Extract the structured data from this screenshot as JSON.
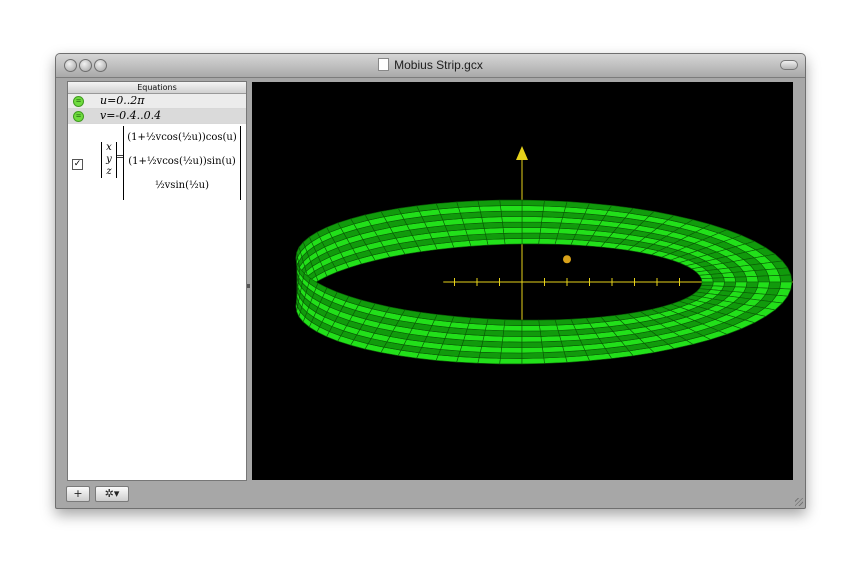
{
  "window": {
    "title": "Mobius Strip.gcx",
    "titlebar_buttons": [
      "close",
      "minimize",
      "zoom"
    ]
  },
  "equations_panel": {
    "header": "Equations",
    "rows": [
      {
        "text": "u=0..2π",
        "selected": false
      },
      {
        "text": "v=-0.4..0.4",
        "selected": true
      }
    ],
    "parametric": {
      "checked": true,
      "vector": [
        "x",
        "y",
        "z"
      ],
      "components": [
        "(1+½vcos(½u))cos(u)",
        "(1+½vcos(½u))sin(u)",
        "½vsin(½u)"
      ]
    }
  },
  "graph": {
    "background": "#000000",
    "surface_color": "#22e01a",
    "axis_color": "#e6d21a"
  },
  "toolbar": {
    "add_label": "+",
    "action_label": "✲▾"
  }
}
